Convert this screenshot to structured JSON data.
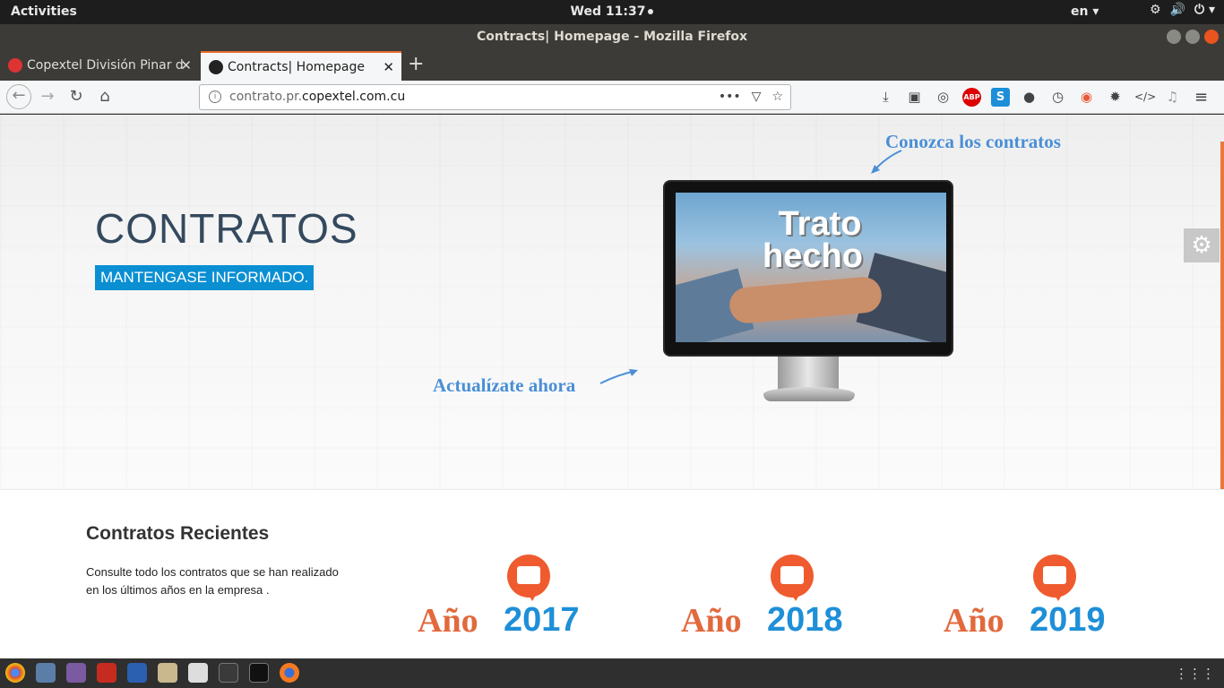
{
  "topbar": {
    "activities": "Activities",
    "clock": "Wed 11:37",
    "lang": "en ▾",
    "tray": [
      "⚙",
      "🔊",
      "⏻ ▾"
    ]
  },
  "window": {
    "title": "Contracts| Homepage - Mozilla Firefox"
  },
  "tabs": [
    {
      "label": "Copextel División Pinar d",
      "close": "✕"
    },
    {
      "label": "Contracts| Homepage",
      "close": "✕"
    }
  ],
  "newtab": "+",
  "nav": {
    "back": "←",
    "forward": "→",
    "reload": "↻",
    "home": "⌂"
  },
  "url": {
    "prefix": "contrato.pr.",
    "domain": "copextel.com.cu",
    "actions": "•••",
    "pocket": "▽",
    "star": "☆",
    "info": "i"
  },
  "toolbar_icons": [
    {
      "name": "download-icon",
      "glyph": "⤓"
    },
    {
      "name": "image-icon",
      "glyph": "▣"
    },
    {
      "name": "globe-icon",
      "glyph": "◎"
    },
    {
      "name": "adblock-icon",
      "glyph": "ABP"
    },
    {
      "name": "s-icon",
      "glyph": "S"
    },
    {
      "name": "mask-icon",
      "glyph": "●"
    },
    {
      "name": "clock-icon",
      "glyph": "◷"
    },
    {
      "name": "record-icon",
      "glyph": "◉"
    },
    {
      "name": "gear-icon",
      "glyph": "✹"
    },
    {
      "name": "code-icon",
      "glyph": "</>"
    },
    {
      "name": "music-icon",
      "glyph": "♫"
    },
    {
      "name": "menu-icon",
      "glyph": "≡"
    }
  ],
  "hero": {
    "title": "CONTRATOS",
    "subtitle": "MANTENGASE INFORMADO.",
    "callout_top": "Conozca los contratos",
    "callout_bottom": "Actualízate ahora",
    "screen_line1": "Trato",
    "screen_line2": "hecho",
    "gear": "⚙"
  },
  "recent": {
    "title": "Contratos Recientes",
    "description": "Consulte todo los contratos que se han realizado en los últimos años en la empresa .",
    "years": [
      {
        "word": "Año",
        "num": "2017"
      },
      {
        "word": "Año",
        "num": "2018"
      },
      {
        "word": "Año",
        "num": "2019"
      }
    ]
  },
  "dock": {
    "grid": "⋮⋮⋮"
  },
  "colors": {
    "accent_blue": "#0b8fd3",
    "callout_blue": "#4a8fd6",
    "year_orange": "#e2693d",
    "year_blue": "#1e8fd8",
    "tab_active_border": "#e86a2a"
  }
}
